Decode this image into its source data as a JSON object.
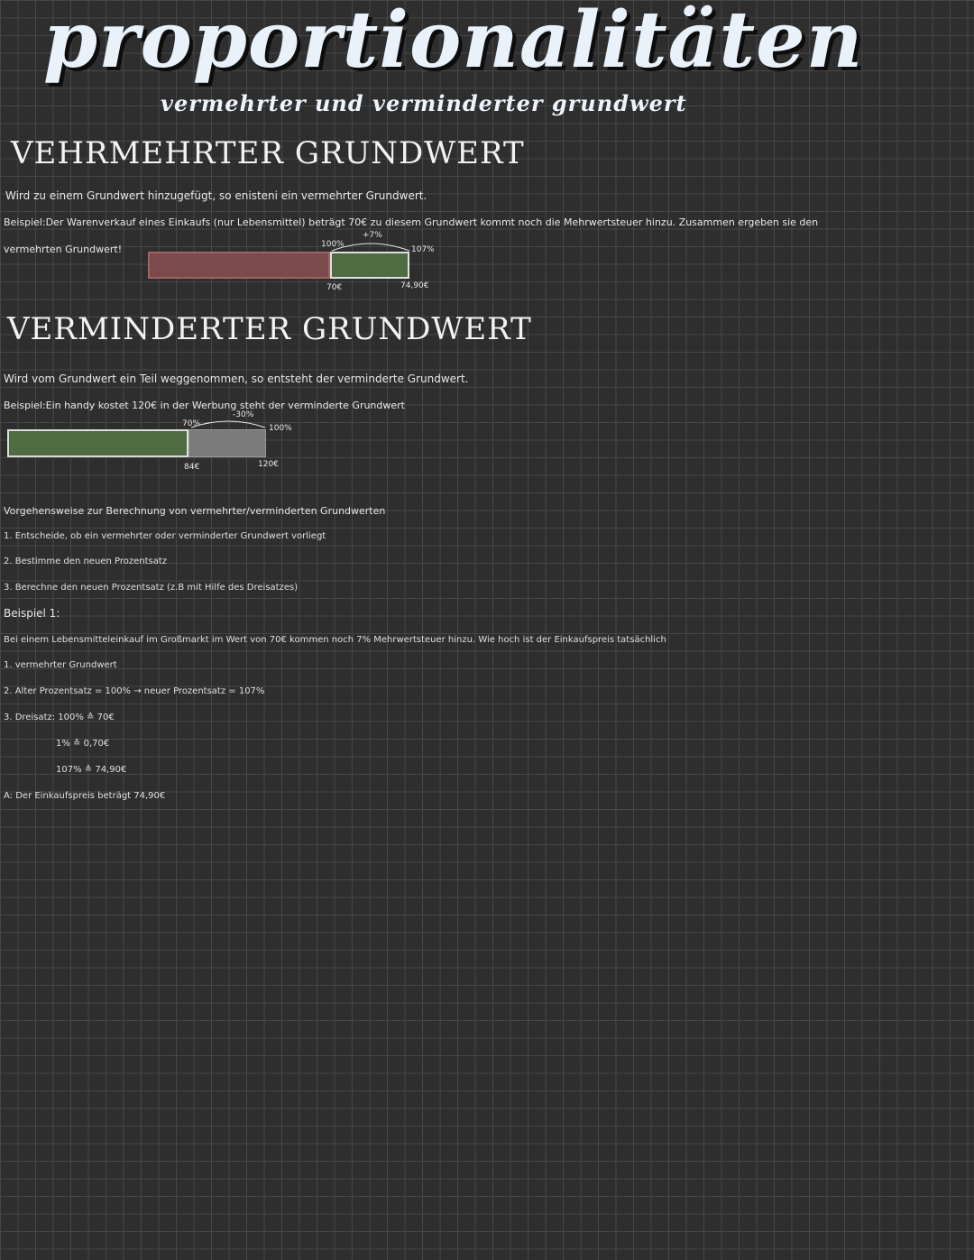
{
  "header": {
    "title": "proportionalitäten",
    "subtitle": "vermehrter und verminderter grundwert"
  },
  "section_increased": {
    "heading": "VEHRMEHRTER GRUNDWERT",
    "definition": "Wird zu einem Grundwert hinzugefügt, so enisteni ein vermehrter Grundwert.",
    "example_line1": "Beispiel:Der Warenverkauf eines Einkaufs (nur Lebensmittel) beträgt 70€ zu diesem Grundwert kommt noch die Mehrwertsteuer hinzu. Zusammen ergeben sie den",
    "example_line2": "vermehrten Grundwert!",
    "diagram": {
      "base_percent_label": "100%",
      "added_percent_label": "+7%",
      "total_percent_label": "107%",
      "base_value_label": "70€",
      "total_value_label": "74,90€",
      "base_color": "#7c4a4a",
      "added_color": "#4f6b41"
    }
  },
  "section_decreased": {
    "heading": "VERMINDERTER GRUNDWERT",
    "definition": "Wird vom Grundwert ein Teil weggenommen, so entsteht der verminderte Grundwert.",
    "example_line1": "Beispiel:Ein handy kostet 120€ in der Werbung steht der verminderte Grundwert",
    "diagram": {
      "reduced_percent_label": "70%",
      "removed_percent_label": "-30%",
      "base_percent_label": "100%",
      "reduced_value_label": "84€",
      "base_value_label": "120€",
      "reduced_color": "#4f6b41",
      "removed_color": "#7a7a7a"
    }
  },
  "procedure": {
    "title": "Vorgehensweise zur Berechnung von vermehrter/verminderten Grundwerten",
    "steps": [
      "1. Entscheide, ob ein vermehrter oder verminderter Grundwert vorliegt",
      "2. Bestimme den neuen Prozentsatz",
      "3. Berechne den neuen Prozentsatz (z.B mit Hilfe des Dreisatzes)"
    ]
  },
  "example1": {
    "title": "Beispiel 1:",
    "statement": "Bei einem Lebensmitteleinkauf im Großmarkt im Wert von 70€ kommen noch 7% Mehrwertsteuer hinzu. Wie hoch ist der Einkaufspreis tatsächlich",
    "lines": [
      "1. vermehrter Grundwert",
      "2. Alter Prozentsatz = 100% → neuer Prozentsatz = 107%",
      "3. Dreisatz: 100% ≙ 70€"
    ],
    "indented_lines": [
      "1% ≙ 0,70€",
      "107% ≙ 74,90€"
    ],
    "answer": "A: Der Einkaufspreis beträgt 74,90€"
  }
}
